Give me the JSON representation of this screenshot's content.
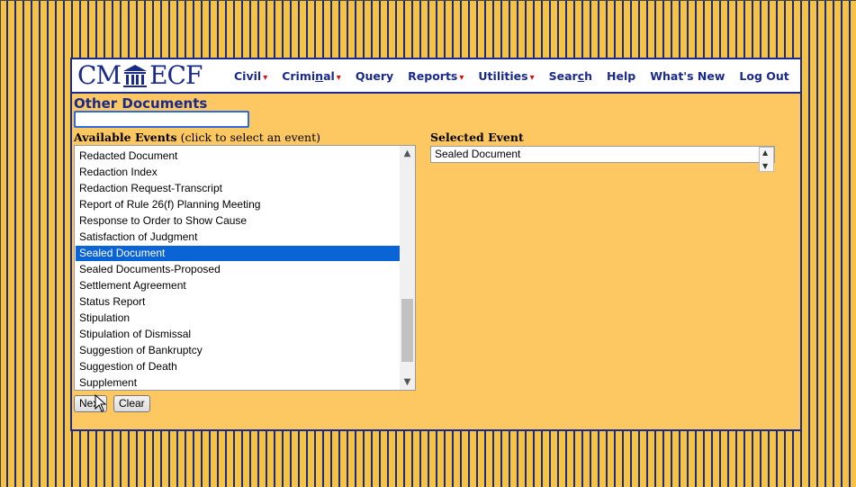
{
  "app": {
    "logo_left": "CM",
    "logo_right": "ECF"
  },
  "menu": [
    {
      "label_pre": "Civil",
      "ul": "",
      "label_post": "",
      "caret": true
    },
    {
      "label_pre": "Crimi",
      "ul": "n",
      "label_post": "al",
      "caret": true
    },
    {
      "label_pre": "Query",
      "ul": "",
      "label_post": "",
      "caret": false
    },
    {
      "label_pre": "Reports",
      "ul": "",
      "label_post": "",
      "caret": true
    },
    {
      "label_pre": "Utilities",
      "ul": "",
      "label_post": "",
      "caret": true
    },
    {
      "label_pre": "Sear",
      "ul": "c",
      "label_post": "h",
      "caret": false
    },
    {
      "label_pre": "Help",
      "ul": "",
      "label_post": "",
      "caret": false
    },
    {
      "label_pre": "What's New",
      "ul": "",
      "label_post": "",
      "caret": false
    },
    {
      "label_pre": "Log Out",
      "ul": "",
      "label_post": "",
      "caret": false
    }
  ],
  "page": {
    "title": "Other Documents",
    "search_value": "",
    "available_label_bold": "Available Events",
    "available_label_rest": " (click to select an event)",
    "selected_label": "Selected Event",
    "selected_value": "Sealed Document"
  },
  "events": [
    "Redacted Document",
    "Redaction Index",
    "Redaction Request-Transcript",
    "Report of Rule 26(f) Planning Meeting",
    "Response to Order to Show Cause",
    "Satisfaction of Judgment",
    "Sealed Document",
    "Sealed Documents-Proposed",
    "Settlement Agreement",
    "Status Report",
    "Stipulation",
    "Stipulation of Dismissal",
    "Suggestion of Bankruptcy",
    "Suggestion of Death",
    "Supplement"
  ],
  "selected_index": 6,
  "buttons": {
    "next": "Next",
    "clear": "Clear"
  },
  "colors": {
    "accent": "#1a2a8c",
    "panel_bg": "#fdc762",
    "selection": "#0a64d6",
    "caret": "#d01010"
  }
}
